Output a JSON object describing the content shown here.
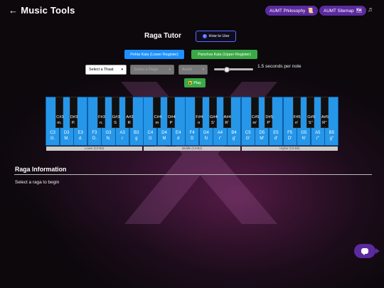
{
  "header": {
    "back_arrow": "←",
    "title": "Music Tools",
    "philosophy_label": "AUMT Philosophy",
    "philosophy_icon": "📜",
    "sitemap_label": "AUMT Sitemap",
    "sitemap_icon": "🗺",
    "music_icon": "♬"
  },
  "tutor": {
    "title": "Raga Tutor",
    "how_to_use": "How to Use",
    "how_icon": "?"
  },
  "registers": {
    "lower": "Pehla Kala (Lower Register)",
    "upper": "Panchva Kala (Upper Register)"
  },
  "controls": {
    "thaat_placeholder": "Select a Thaat",
    "raga_placeholder": "Select a Raga",
    "third_placeholder": "Aaroh",
    "speed_text": "1.5 seconds per note",
    "play_label": "Play",
    "play_icon": "▶"
  },
  "colors": {
    "white_key": "#2696e8",
    "black_key": "#101010",
    "accent_purple": "#5b2a9e",
    "lower_register": "#1e90ff",
    "upper_register": "#3aa846"
  },
  "keyboard": {
    "white_keys": [
      [
        "C3",
        "G."
      ],
      [
        "D3",
        "M."
      ],
      [
        "E3",
        "d."
      ],
      [
        "F3",
        "D."
      ],
      [
        "G3",
        "N."
      ],
      [
        "A3",
        "r"
      ],
      [
        "B3",
        "g"
      ],
      [
        "C4",
        "G"
      ],
      [
        "D4",
        "M"
      ],
      [
        "E4",
        "d"
      ],
      [
        "F4",
        "D"
      ],
      [
        "G4",
        "N"
      ],
      [
        "A4",
        "r'"
      ],
      [
        "B4",
        "g'"
      ],
      [
        "C5",
        "G'"
      ],
      [
        "D5",
        "M'"
      ],
      [
        "E5",
        "d'"
      ],
      [
        "F5",
        "D'"
      ],
      [
        "G5",
        "N'"
      ],
      [
        "A5",
        "r''"
      ],
      [
        "B5",
        "g''"
      ]
    ],
    "black_keys": [
      [
        "C#3",
        "m."
      ],
      [
        "D#3",
        "P."
      ],
      [
        "F#3",
        "n."
      ],
      [
        "G#3",
        "S"
      ],
      [
        "A#3",
        "R"
      ],
      [
        "C#4",
        "m"
      ],
      [
        "D#4",
        "P"
      ],
      [
        "F#4",
        "n"
      ],
      [
        "G#4",
        "S'"
      ],
      [
        "A#4",
        "R'"
      ],
      [
        "C#5",
        "m'"
      ],
      [
        "D#5",
        "P'"
      ],
      [
        "F#5",
        "n'"
      ],
      [
        "G#5",
        "S''"
      ],
      [
        "A#5",
        "R''"
      ]
    ],
    "octave_labels": [
      "Lower (C3-B3)",
      "Middle (C4-B4)",
      "Higher (C5-B5)"
    ]
  },
  "info": {
    "title": "Raga Information",
    "text": "Select a raga to begin"
  }
}
